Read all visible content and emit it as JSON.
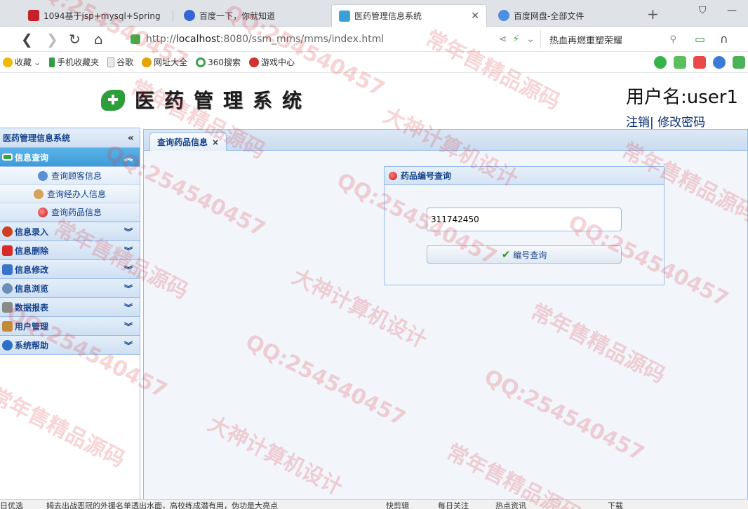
{
  "browser": {
    "tabs": [
      {
        "title": "1094基于jsp+mysql+Spring+",
        "icon_color": "#c8202a"
      },
      {
        "title": "百度一下，你就知道",
        "icon_color": "#3466d6"
      },
      {
        "title": "医药管理信息系统",
        "icon_color": "#3aa0d8",
        "active": true
      },
      {
        "title": "百度网盘-全部文件",
        "icon_color": "#4f8fe0"
      }
    ],
    "url_prefix": "http://",
    "url_host": "localhost",
    "url_rest": ":8080/ssm_mms/mms/index.html",
    "search_text": "热血再燃重塑荣耀",
    "favorites": [
      {
        "label": "收藏",
        "color": "#f2b705"
      },
      {
        "label": "手机收藏夹",
        "color": "#2f9e44"
      },
      {
        "label": "谷歌",
        "color": "#9aa4ae"
      },
      {
        "label": "网址大全",
        "color": "#e5a400"
      },
      {
        "label": "360搜索",
        "color": "#3aa34a"
      },
      {
        "label": "游戏中心",
        "color": "#d0342c"
      }
    ]
  },
  "app": {
    "logo_text": "医药管理系统",
    "user_label": "用户名:user1",
    "logout": "注销",
    "separator": "|",
    "change_password": "修改密码"
  },
  "sidebar": {
    "title": "医药管理信息系统",
    "collapse_glyph": "«",
    "sections": [
      {
        "label": "信息查询",
        "open": true,
        "icon_color": "#3aa34a",
        "items": [
          {
            "label": "查询顾客信息",
            "icon_color": "#5b8fd6"
          },
          {
            "label": "查询经办人信息",
            "icon_color": "#d6a35b"
          },
          {
            "label": "查询药品信息",
            "icon_color": "#e04848",
            "selected": true
          }
        ]
      },
      {
        "label": "信息录入",
        "icon_color": "#d04020"
      },
      {
        "label": "信息删除",
        "icon_color": "#d82a2a"
      },
      {
        "label": "信息修改",
        "icon_color": "#3a74c8"
      },
      {
        "label": "信息浏览",
        "icon_color": "#6b8fb8"
      },
      {
        "label": "数据报表",
        "icon_color": "#8a8a8a"
      },
      {
        "label": "用户管理",
        "icon_color": "#c48a3a"
      },
      {
        "label": "系统帮助",
        "icon_color": "#2a6fc8"
      }
    ]
  },
  "main": {
    "tab_label": "查询药品信息",
    "tab_close": "×",
    "panel_title": "药品编号查询",
    "input_value": "311742450",
    "button_label": "编号查询"
  },
  "statusbar": {
    "left": "日优选",
    "news": "姆去出战恶冠的外援名单透出水面，高校练成潜有用，伪功是大亮点",
    "items": [
      "快剪辑",
      "每日关注",
      "热点资讯",
      "下载"
    ]
  },
  "watermarks": [
    "QQ:254540457",
    "常年售精品源码",
    "大神计算机设计"
  ]
}
